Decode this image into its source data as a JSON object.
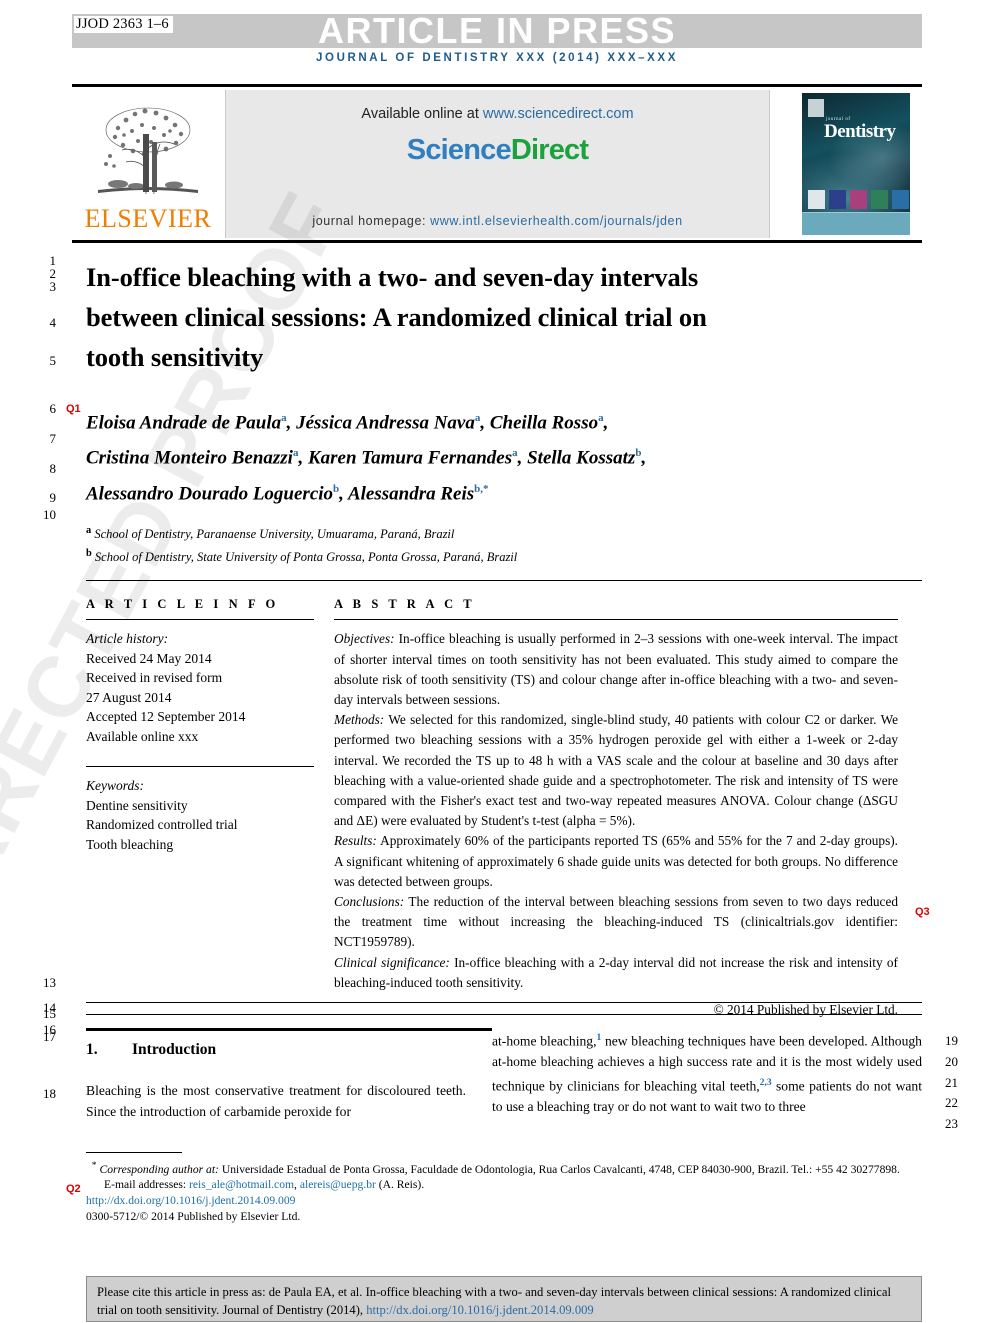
{
  "header": {
    "article_code": "JJOD 2363 1–6",
    "banner": "ARTICLE IN PRESS",
    "journal_line": "JOURNAL OF DENTISTRY XXX (2014) XXX–XXX"
  },
  "masthead": {
    "publisher": "ELSEVIER",
    "available_prefix": "Available online at ",
    "available_url": "www.sciencedirect.com",
    "sciencedirect_part1": "Science",
    "sciencedirect_part2": "Direct",
    "homepage_label": "journal homepage: ",
    "homepage_url": "www.intl.elsevierhealth.com/journals/jden",
    "cover_small_label": "journal of",
    "cover_title": "Dentistry"
  },
  "article": {
    "title": "In-office bleaching with a two- and seven-day intervals between clinical sessions: A randomized clinical trial on tooth sensitivity",
    "authors_line1": "Eloisa Andrade de Paula",
    "authors_line1_b": "Jéssica Andressa Nava",
    "authors_line1_c": "Cheilla Rosso",
    "authors_line2": "Cristina Monteiro Benazzi",
    "authors_line2_b": "Karen Tamura Fernandes",
    "authors_line2_c": "Stella Kossatz",
    "authors_line3": "Alessandro Dourado Loguercio",
    "authors_line3_b": "Alessandra Reis",
    "affiliation_a": "School of Dentistry, Paranaense University, Umuarama, Paraná, Brazil",
    "affiliation_b": "School of Dentistry, State University of Ponta Grossa, Ponta Grossa, Paraná, Brazil"
  },
  "article_info": {
    "heading": "A R T I C L E   I N F O",
    "history_label": "Article history:",
    "history": [
      "Received 24 May 2014",
      "Received in revised form",
      "27 August 2014",
      "Accepted 12 September 2014",
      "Available online xxx"
    ],
    "keywords_label": "Keywords:",
    "keywords": [
      "Dentine sensitivity",
      "Randomized controlled trial",
      "Tooth bleaching"
    ]
  },
  "abstract": {
    "heading": "A B S T R A C T",
    "objectives_label": "Objectives:",
    "objectives": " In-office bleaching is usually performed in 2–3 sessions with one-week interval. The impact of shorter interval times on tooth sensitivity has not been evaluated. This study aimed to compare the absolute risk of tooth sensitivity (TS) and colour change after in-office bleaching with a two- and seven-day intervals between sessions.",
    "methods_label": "Methods:",
    "methods": " We selected for this randomized, single-blind study, 40 patients with colour C2 or darker. We performed two bleaching sessions with a 35% hydrogen peroxide gel with either a 1-week or 2-day interval. We recorded the TS up to 48 h with a VAS scale and the colour at baseline and 30 days after bleaching with a value-oriented shade guide and a spectrophotometer. The risk and intensity of TS were compared with the Fisher's exact test and two-way repeated measures ANOVA. Colour change (ΔSGU and ΔE) were evaluated by Student's t-test (alpha = 5%).",
    "results_label": "Results:",
    "results": " Approximately 60% of the participants reported TS (65% and 55% for the 7 and 2-day groups). A significant whitening of approximately 6 shade guide units was detected for both groups. No difference was detected between groups.",
    "conclusions_label": "Conclusions:",
    "conclusions": " The reduction of the interval between bleaching sessions from seven to two days reduced the treatment time without increasing the bleaching-induced TS (clinicaltrials.gov identifier: NCT1959789).",
    "significance_label": "Clinical significance:",
    "significance": " In-office bleaching with a 2-day interval did not increase the risk and intensity of bleaching-induced tooth sensitivity.",
    "copyright": "© 2014 Published by Elsevier Ltd."
  },
  "introduction": {
    "number": "1.",
    "heading": "Introduction",
    "left_text": "Bleaching is the most conservative treatment for discoloured teeth. Since the introduction of carbamide peroxide for",
    "right_text_1": "at-home bleaching,",
    "right_sup_1": "1",
    "right_text_2": " new bleaching techniques have been developed. Although at-home bleaching achieves a high success rate and it is the most widely used technique by clinicians for bleaching vital teeth,",
    "right_sup_2": "2,3",
    "right_text_3": " some patients do not want to use a bleaching tray or do not want to wait two to three"
  },
  "footnote": {
    "star": "*",
    "corresponding_label": "Corresponding author at:",
    "corresponding_text": " Universidade Estadual de Ponta Grossa, Faculdade de Odontologia, Rua Carlos Cavalcanti, 4748, CEP 84030-900, Brazil. Tel.: +55 42 30277898.",
    "email_label": "E-mail addresses:",
    "email_1": "reis_ale@hotmail.com",
    "email_2": "alereis@uepg.br",
    "email_suffix": " (A. Reis).",
    "doi": "http://dx.doi.org/10.1016/j.jdent.2014.09.009",
    "issn_line": "0300-5712/© 2014 Published by Elsevier Ltd."
  },
  "cite_box": {
    "text": "Please cite this article in press as: de Paula EA, et al. In-office bleaching with a two- and seven-day intervals between clinical sessions: A randomized clinical trial on tooth sensitivity. Journal of Dentistry (2014), ",
    "link": "http://dx.doi.org/10.1016/j.jdent.2014.09.009"
  },
  "watermark": {
    "text": "UNCORRECTED PROOF"
  },
  "line_numbers": {
    "left": [
      "1",
      "2",
      "3",
      "4",
      "5",
      "6",
      "7",
      "8",
      "9",
      "10",
      "13",
      "14",
      "15",
      "16",
      "17",
      "18"
    ],
    "right": [
      "19",
      "20",
      "21",
      "22",
      "23"
    ]
  },
  "queries": {
    "q1": "Q1",
    "q2": "Q2",
    "q3": "Q3"
  },
  "colors": {
    "banner_grey": "#c6c6c6",
    "journal_blue": "#1f5c8b",
    "link_blue": "#2b6ca3",
    "sciencedirect_green": "#1BA23C",
    "elsevier_orange": "#F07C00",
    "query_red": "#e00000"
  }
}
